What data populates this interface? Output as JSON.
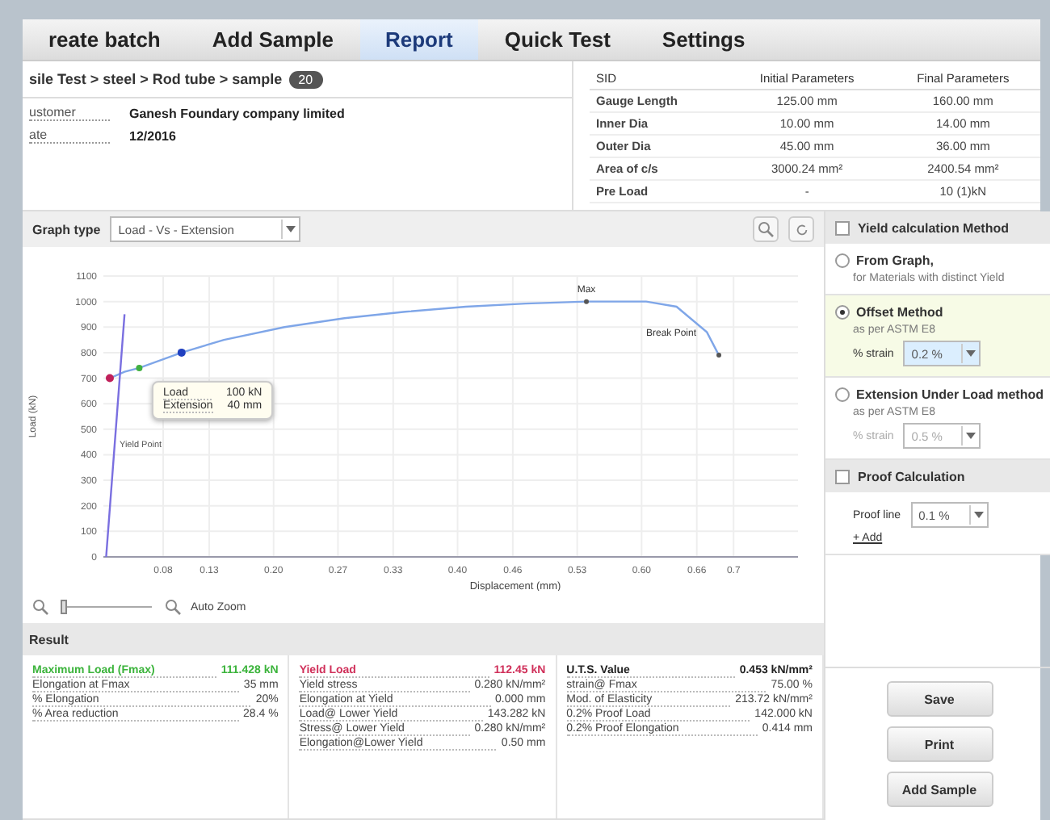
{
  "tabs": [
    {
      "label": "reate batch",
      "selected": false
    },
    {
      "label": "Add Sample",
      "selected": false
    },
    {
      "label": "Report",
      "selected": true
    },
    {
      "label": "Quick Test",
      "selected": false
    },
    {
      "label": "Settings",
      "selected": false
    }
  ],
  "breadcrumb": {
    "path": "sile Test > steel > Rod tube > sample",
    "badge": "20"
  },
  "info": [
    {
      "label": "ustomer",
      "value": "Ganesh Foundary company limited"
    },
    {
      "label": "ate",
      "value": "12/2016"
    }
  ],
  "parameters": {
    "columns": [
      "SID",
      "Initial Parameters",
      "Final Parameters"
    ],
    "rows": [
      [
        "Gauge Length",
        "125.00 mm",
        "160.00 mm"
      ],
      [
        "Inner Dia",
        "10.00 mm",
        "14.00 mm"
      ],
      [
        "Outer Dia",
        "45.00 mm",
        "36.00 mm"
      ],
      [
        "Area of c/s",
        "3000.24 mm²",
        "2400.54 mm²"
      ],
      [
        "Pre Load",
        "-",
        "10 (1)kN"
      ]
    ]
  },
  "graph": {
    "type_label": "Graph type",
    "type_value": "Load - Vs - Extension",
    "y_title": "Load (kN)",
    "yield_label": "Yield Point",
    "tooltip": [
      {
        "label": "Load",
        "value": "100 kN"
      },
      {
        "label": "Extension",
        "value": "40 mm"
      }
    ],
    "zoom": {
      "label": "Auto Zoom",
      "level": 0
    },
    "chart_data": {
      "type": "line",
      "xlabel": "Displacement (mm)",
      "x": [
        0.018,
        0.022,
        0.038,
        0.054,
        0.1,
        0.146,
        0.212,
        0.277,
        0.343,
        0.409,
        0.474,
        0.54,
        0.605,
        0.638,
        0.671,
        0.684
      ],
      "series": [
        {
          "color": "#7fa6e8",
          "values": [
            null,
            700,
            725,
            740,
            800,
            850,
            900,
            935,
            960,
            980,
            992,
            1000,
            1000,
            980,
            880,
            790
          ]
        },
        {
          "color": "#7a6fe0",
          "values": [
            0,
            190,
            950,
            null,
            null,
            null,
            null,
            null,
            null,
            null,
            null,
            null,
            null,
            null,
            null,
            null
          ]
        }
      ],
      "xlim": [
        0.015,
        0.77
      ],
      "ylim": [
        0,
        1100
      ],
      "grid": true,
      "xticks": [
        {
          "value": 0.08,
          "label": "0.08"
        },
        {
          "value": 0.13,
          "label": "0.13"
        },
        {
          "value": 0.2,
          "label": "0.20"
        },
        {
          "value": 0.27,
          "label": "0.27"
        },
        {
          "value": 0.33,
          "label": "0.33"
        },
        {
          "value": 0.4,
          "label": "0.40"
        },
        {
          "value": 0.46,
          "label": "0.46"
        },
        {
          "value": 0.53,
          "label": "0.53"
        },
        {
          "value": 0.6,
          "label": "0.60"
        },
        {
          "value": 0.66,
          "label": "0.66"
        },
        {
          "value": 0.7,
          "label": "0.7"
        }
      ],
      "yticks": [
        0,
        100,
        200,
        300,
        400,
        500,
        600,
        700,
        800,
        900,
        1000,
        1100
      ],
      "annotations": [
        {
          "x": 0.54,
          "y": 1000,
          "text": "Max"
        },
        {
          "x": 0.684,
          "y": 790,
          "text": "Break Point"
        }
      ]
    }
  },
  "result": {
    "title": "Result",
    "groups": [
      {
        "color": "#3cb43c",
        "rows": [
          [
            "Maximum Load (Fmax)",
            "111.428 kN"
          ],
          [
            "Elongation at Fmax",
            "35 mm"
          ],
          [
            "% Elongation",
            "20%"
          ],
          [
            "% Area reduction",
            "28.4 %"
          ]
        ]
      },
      {
        "color": "#d0305a",
        "rows": [
          [
            "Yield Load",
            "112.45 kN"
          ],
          [
            "Yield stress",
            "0.280 kN/mm²"
          ],
          [
            "Elongation at Yield",
            "0.000 mm"
          ],
          [
            "Load@ Lower Yield",
            "143.282 kN"
          ],
          [
            "Stress@ Lower Yield",
            "0.280 kN/mm²"
          ],
          [
            "Elongation@Lower Yield",
            "0.50 mm"
          ]
        ]
      },
      {
        "color": "#222222",
        "rows": [
          [
            "U.T.S. Value",
            "0.453 kN/mm²"
          ],
          [
            "strain@ Fmax",
            "75.00 %"
          ],
          [
            "Mod. of Elasticity",
            "213.72 kN/mm²"
          ],
          [
            "0.2% Proof Load",
            "142.000 kN"
          ],
          [
            "0.2% Proof Elongation",
            "0.414 mm"
          ]
        ]
      }
    ]
  },
  "yield_method": {
    "title": "Yield calculation Method",
    "checked": false,
    "options": [
      {
        "title": "From Graph,",
        "note": "for Materials with distinct Yield",
        "selected": false
      },
      {
        "title": "Offset Method",
        "note": "as per ASTM E8",
        "selected": true,
        "strain_label": "% strain",
        "strain": "0.2 %"
      },
      {
        "title": "Extension Under Load method",
        "note": "as per ASTM E8",
        "selected": false,
        "strain_label": "% strain",
        "strain": "0.5 %"
      }
    ]
  },
  "proof": {
    "title": "Proof Calculation",
    "checked": false,
    "line_label": "Proof line",
    "line": "0.1 %",
    "add": "+ Add"
  },
  "buttons": [
    "Save",
    "Print",
    "Add Sample"
  ]
}
